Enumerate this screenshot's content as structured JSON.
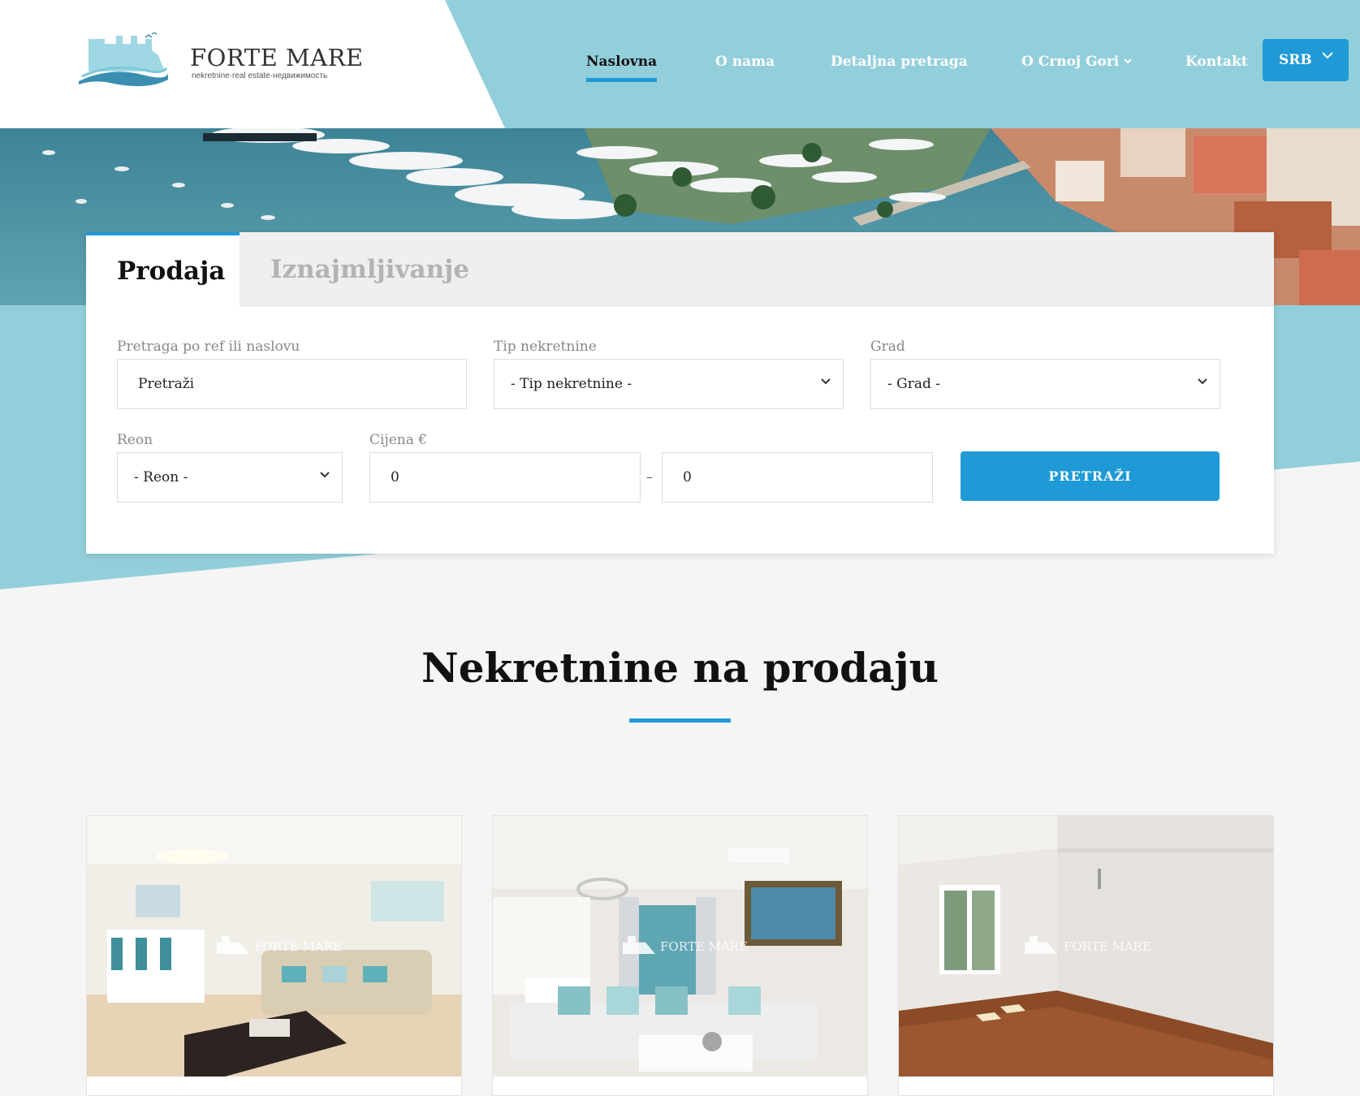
{
  "header": {
    "logo_title": "FORTE MARE",
    "logo_subtitle": "nekretnine·real estate·недвижимость",
    "nav": [
      {
        "label": "Naslovna",
        "active": true
      },
      {
        "label": "O nama"
      },
      {
        "label": "Detaljna pretraga"
      },
      {
        "label": "O Crnoj Gori",
        "has_dropdown": true
      },
      {
        "label": "Kontakt"
      }
    ],
    "language": "SRB"
  },
  "search": {
    "tabs": [
      {
        "label": "Prodaja",
        "active": true
      },
      {
        "label": "Iznajmljivanje"
      }
    ],
    "ref_label": "Pretraga po ref ili naslovu",
    "ref_value": "Pretraži",
    "type_label": "Tip nekretnine",
    "type_value": "- Tip nekretnine -",
    "city_label": "Grad",
    "city_value": "- Grad -",
    "area_label": "Reon",
    "area_value": "- Reon -",
    "price_label": "Cijena €",
    "price_min": "0",
    "price_separator": "–",
    "price_max": "0",
    "button": "PRETRAŽI"
  },
  "listings": {
    "title": "Nekretnine na prodaju",
    "watermark": "FORTE MARE",
    "cards": [
      {
        "image": "living-room-photo"
      },
      {
        "image": "living-room-kitchen-photo"
      },
      {
        "image": "empty-room-photo"
      }
    ]
  },
  "colors": {
    "accent": "#1f9ad6",
    "teal": "#93cfdb",
    "background": "#f5f5f5"
  }
}
